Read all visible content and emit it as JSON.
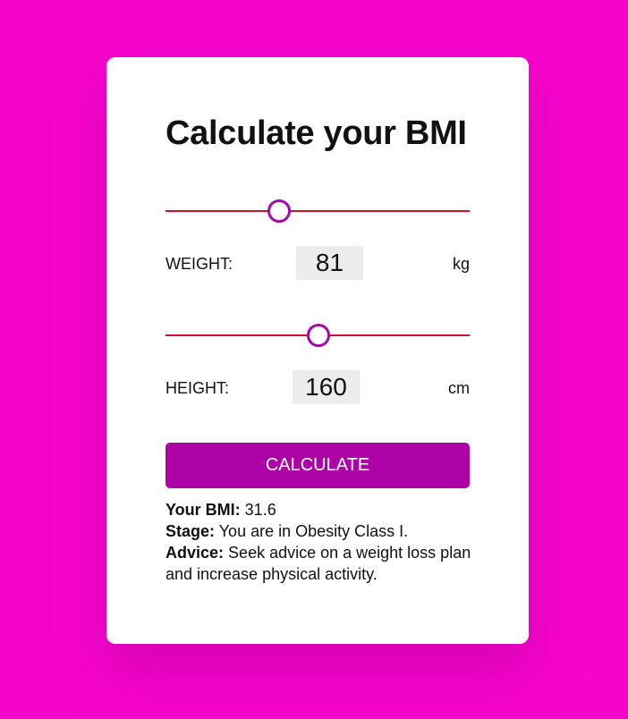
{
  "page": {
    "background_color": "#f704cc",
    "accent_color": "#ad03a6",
    "track_color": "#d0102a"
  },
  "card": {
    "title": "Calculate your BMI"
  },
  "weight": {
    "label": "WEIGHT:",
    "value": "81",
    "unit": "kg",
    "slider_fraction": 0.37
  },
  "height": {
    "label": "HEIGHT:",
    "value": "160",
    "unit": "cm",
    "slider_fraction": 0.5
  },
  "calculate_button": {
    "label": "CALCULATE"
  },
  "results": {
    "bmi_label": "Your BMI:",
    "bmi_value": "31.6",
    "stage_label": "Stage:",
    "stage_value": "You are in Obesity Class I.",
    "advice_label": "Advice:",
    "advice_value": "Seek advice on a weight loss plan and increase physical activity."
  }
}
